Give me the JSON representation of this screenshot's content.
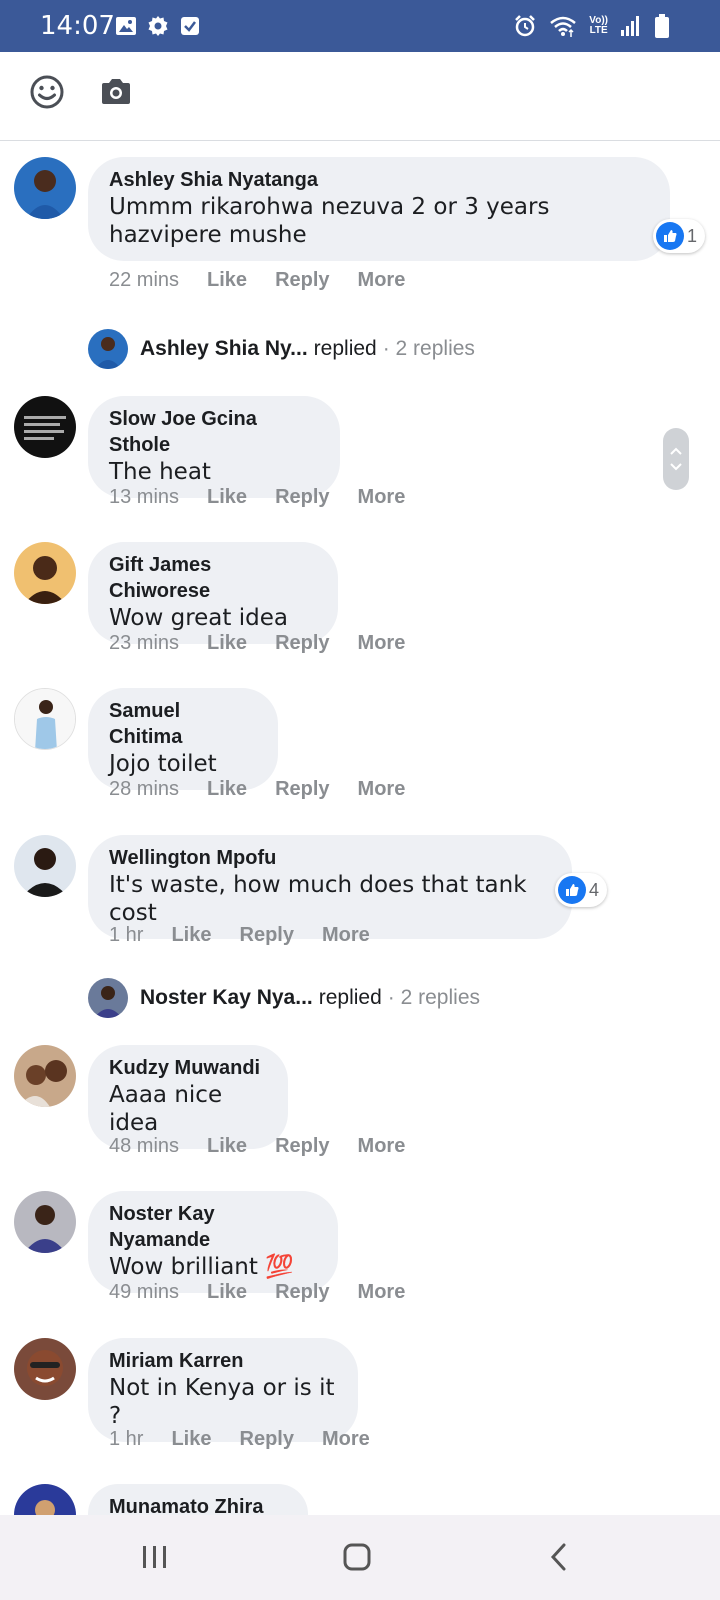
{
  "status_bar": {
    "time": "14:07",
    "left_icons": [
      "image-icon",
      "gear-icon",
      "checkbox-icon"
    ],
    "right_icons": [
      "alarm-icon",
      "wifi-icon",
      "volte-icon",
      "signal-icon",
      "battery-icon"
    ],
    "volte_top": "Vo))",
    "volte_bottom": "LTE",
    "background": "#3b5998"
  },
  "composer": {
    "tools": [
      "emoji-icon",
      "camera-icon"
    ]
  },
  "comments": [
    {
      "author": "Ashley Shia Nyatanga",
      "text": "Ummm rikarohwa nezuva 2 or 3 years hazvipere mushe",
      "time": "22 mins",
      "like_label": "Like",
      "reply_label": "Reply",
      "more_label": "More",
      "reactions": "1"
    },
    {
      "author": "Slow Joe Gcina Sthole",
      "text": "The heat",
      "time": "13 mins",
      "like_label": "Like",
      "reply_label": "Reply",
      "more_label": "More"
    },
    {
      "author": "Gift James Chiworese",
      "text": "Wow great idea",
      "time": "23 mins",
      "like_label": "Like",
      "reply_label": "Reply",
      "more_label": "More"
    },
    {
      "author": "Samuel Chitima",
      "text": "Jojo toilet",
      "time": "28 mins",
      "like_label": "Like",
      "reply_label": "Reply",
      "more_label": "More"
    },
    {
      "author": "Wellington Mpofu",
      "text": "It's waste, how much does that tank cost",
      "time": "1 hr",
      "like_label": "Like",
      "reply_label": "Reply",
      "more_label": "More",
      "reactions": "4"
    },
    {
      "author": "Kudzy Muwandi",
      "text": "Aaaa nice idea",
      "time": "48 mins",
      "like_label": "Like",
      "reply_label": "Reply",
      "more_label": "More"
    },
    {
      "author": "Noster Kay Nyamande",
      "text": "Wow brilliant 💯",
      "time": "49 mins",
      "like_label": "Like",
      "reply_label": "Reply",
      "more_label": "More"
    },
    {
      "author": "Miriam Karren",
      "text": "Not in Kenya or is it ?",
      "time": "1 hr",
      "like_label": "Like",
      "reply_label": "Reply",
      "more_label": "More"
    },
    {
      "author": "Munamato Zhira"
    }
  ],
  "reply_threads": [
    {
      "name": "Ashley Shia Ny...",
      "replied": "replied",
      "count": "· 2 replies"
    },
    {
      "name": "Noster Kay Nya...",
      "replied": "replied",
      "count": "· 2 replies"
    }
  ],
  "nav_bar": {
    "buttons": [
      "recent-apps-icon",
      "home-icon",
      "back-icon"
    ]
  },
  "colors": {
    "bubble": "#eef0f4",
    "meta": "#8a8d91",
    "like_blue": "#1877f2"
  }
}
